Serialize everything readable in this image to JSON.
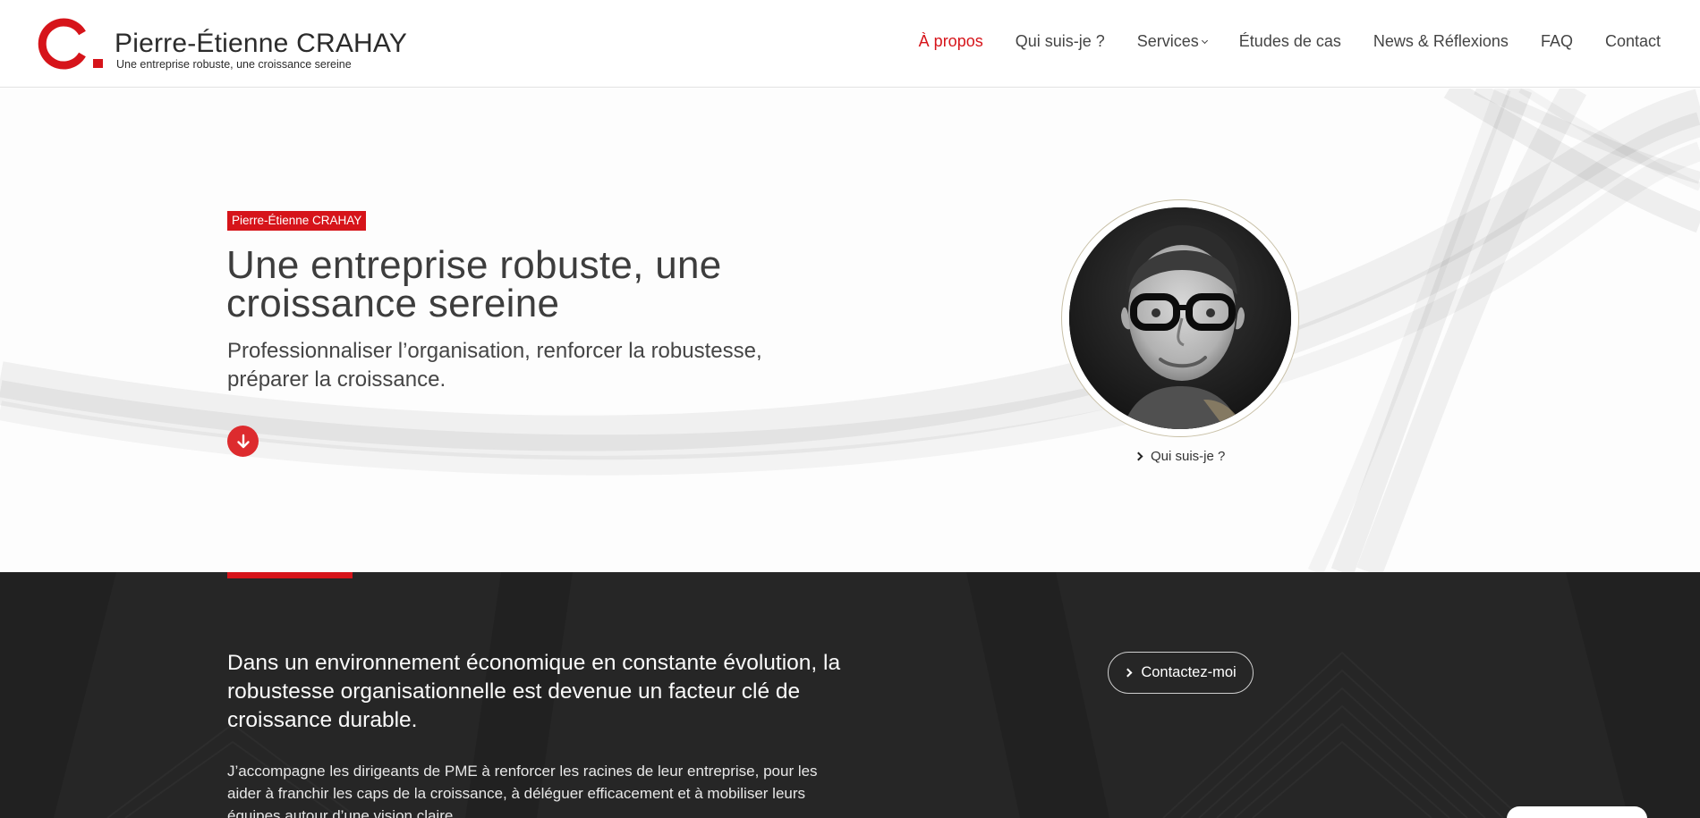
{
  "header": {
    "logo": {
      "name": "Pierre-Étienne CRAHAY",
      "tagline": "Une entreprise robuste, une croissance sereine",
      "mark_color": "#d6141a"
    },
    "nav": [
      {
        "label": "À propos",
        "active": true
      },
      {
        "label": "Qui suis-je ?"
      },
      {
        "label": "Services",
        "has_dropdown": true
      },
      {
        "label": "Études de cas"
      },
      {
        "label": "News & Réflexions"
      },
      {
        "label": "FAQ"
      },
      {
        "label": "Contact"
      }
    ]
  },
  "hero": {
    "badge": "Pierre-Étienne CRAHAY",
    "title": "Une entreprise robuste, une croissance sereine",
    "subtitle": "Professionnaliser l’organisation, renforcer la robustesse, préparer la croissance.",
    "scroll_icon": "arrow-down-icon",
    "portrait_link": "Qui suis-je ?"
  },
  "intro": {
    "lead": "Dans un environnement économique en constante évolution, la robustesse organisationnelle est devenue un facteur clé de croissance durable.",
    "body": "J’accompagne les dirigeants de PME à renforcer les racines de leur entreprise, pour les aider à franchir les caps de la croissance, à déléguer efficacement et à mobiliser leurs équipes autour d’une vision claire.",
    "cta": "Contactez-moi"
  },
  "colors": {
    "accent": "#d6141a",
    "dark_section": "#262626",
    "text": "#3d3d3d"
  }
}
